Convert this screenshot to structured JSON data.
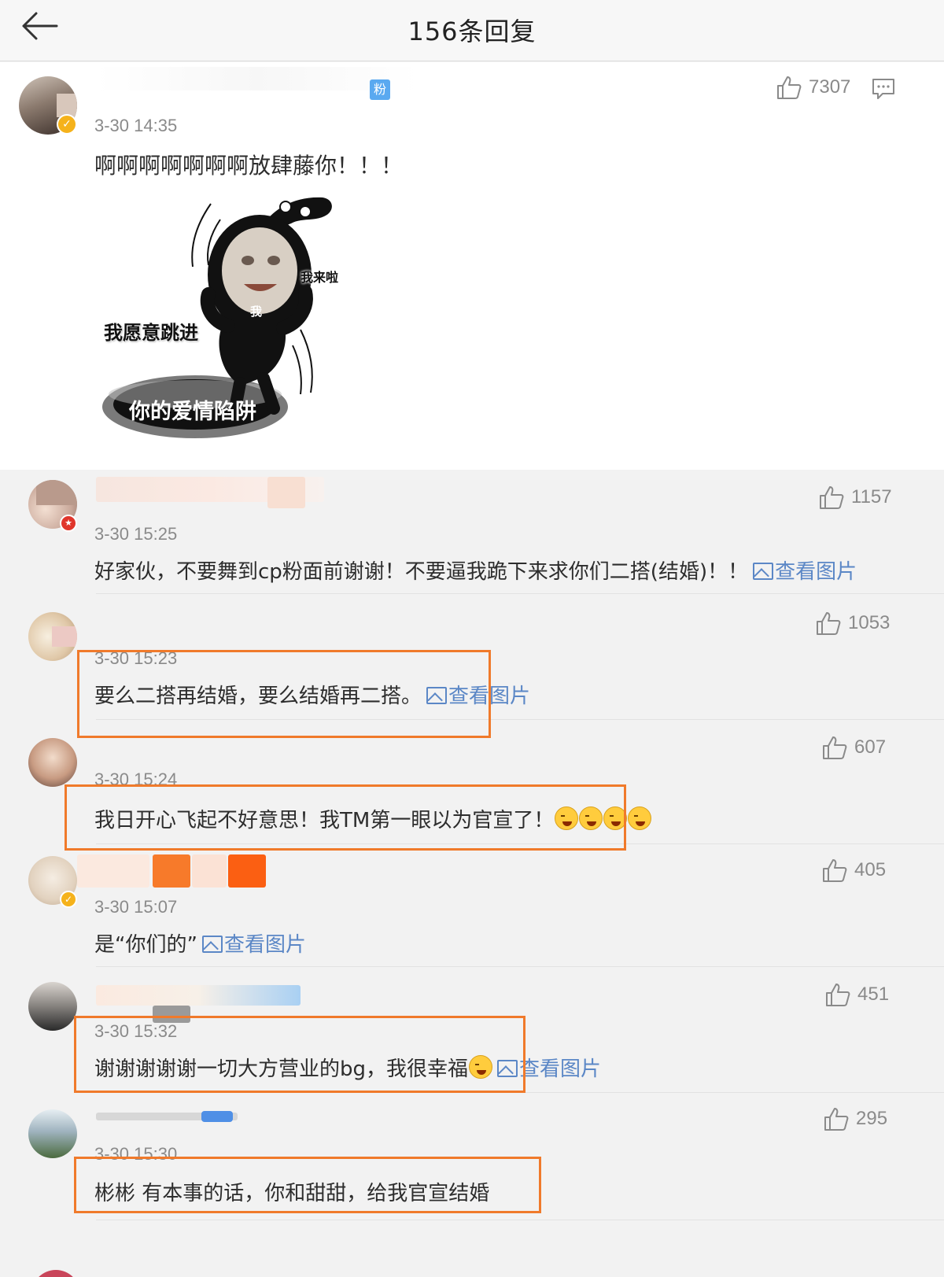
{
  "header": {
    "title": "156条回复"
  },
  "main_comment": {
    "badge": "粉",
    "time": "3-30 14:35",
    "likes": "7307",
    "text": "啊啊啊啊啊啊啊放肆藤你！！！",
    "meme": {
      "label_top": "我来啦",
      "label_body": "我",
      "label_left": "我愿意跳进",
      "label_bottom": "你的爱情陷阱"
    }
  },
  "image_link_label": "查看图片",
  "replies": [
    {
      "time": "3-30 15:25",
      "likes": "1157",
      "text": "好家伙，不要舞到cp粉面前谢谢！不要逼我跪下来求你们二搭(结婚)！！",
      "has_image": true
    },
    {
      "time": "3-30 15:23",
      "likes": "1053",
      "text": "要么二搭再结婚，要么结婚再二搭。",
      "has_image": true
    },
    {
      "time": "3-30 15:24",
      "likes": "607",
      "text": "我日开心飞起不好意思！我TM第一眼以为官宣了！",
      "has_image": false,
      "emoji_count": 4
    },
    {
      "time": "3-30 15:07",
      "likes": "405",
      "text": "是“你们的”",
      "has_image": true
    },
    {
      "time": "3-30 15:32",
      "likes": "451",
      "text": "谢谢谢谢谢一切大方营业的bg，我很幸福",
      "has_image": true,
      "emoji_count": 1
    },
    {
      "time": "3-30 15:30",
      "likes": "295",
      "text": "彬彬 有本事的话，你和甜甜，给我官宣结婚",
      "has_image": false
    }
  ],
  "colors": {
    "highlight": "#f07a2b",
    "link": "#5b87c6",
    "vip_gold": "#f5b21b",
    "vip_red": "#e0352b"
  }
}
